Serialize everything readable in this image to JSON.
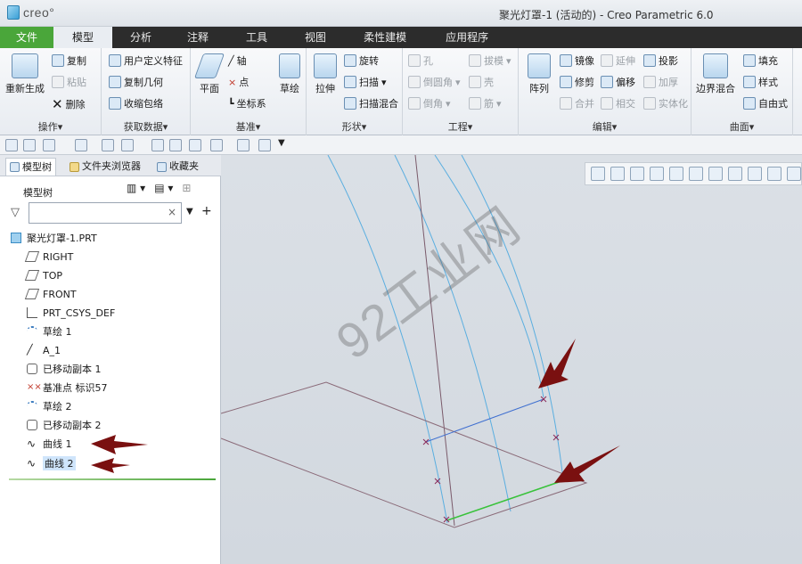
{
  "window": {
    "logo_text": "creo°",
    "title": "聚光灯罩-1 (活动的) - Creo Parametric 6.0"
  },
  "tabs": [
    {
      "label": "文件"
    },
    {
      "label": "模型"
    },
    {
      "label": "分析"
    },
    {
      "label": "注释"
    },
    {
      "label": "工具"
    },
    {
      "label": "视图"
    },
    {
      "label": "柔性建模"
    },
    {
      "label": "应用程序"
    }
  ],
  "ribbon": {
    "groups": {
      "operations": "操作▾",
      "get_data": "获取数据▾",
      "datum": "基准▾",
      "shapes": "形状▾",
      "engineering": "工程▾",
      "editing": "编辑▾",
      "surfaces": "曲面▾"
    },
    "buttons": {
      "regenerate": "重新生成",
      "copy": "复制",
      "paste": "粘贴",
      "delete": "删除",
      "udf": "用户定义特征",
      "copy_geometry": "复制几何",
      "shrinkwrap": "收缩包络",
      "plane": "平面",
      "axis": "轴",
      "point": "点",
      "csys": "坐标系",
      "sketch": "草绘",
      "extrude": "拉伸",
      "revolve": "旋转",
      "sweep": "扫描",
      "swept_blend": "扫描混合",
      "hole": "孔",
      "round": "倒圆角",
      "chamfer": "倒角",
      "draft": "拔模",
      "shell": "壳",
      "rib": "筋",
      "pattern": "阵列",
      "mirror": "镜像",
      "trim": "修剪",
      "merge": "合并",
      "extend": "延伸",
      "offset": "偏移",
      "intersect": "相交",
      "project": "投影",
      "thicken": "加厚",
      "solidify": "实体化",
      "boundary_blend": "边界混合",
      "fill": "填充",
      "style": "样式",
      "freestyle": "自由式"
    }
  },
  "panel": {
    "tabs": [
      "模型树",
      "文件夹浏览器",
      "收藏夹"
    ],
    "tree_title": "模型树",
    "search_placeholder": "",
    "tree": [
      {
        "label": "聚光灯罩-1.PRT",
        "icon": "part-icon"
      },
      {
        "label": "RIGHT",
        "icon": "datum-plane-icon"
      },
      {
        "label": "TOP",
        "icon": "datum-plane-icon"
      },
      {
        "label": "FRONT",
        "icon": "datum-plane-icon"
      },
      {
        "label": "PRT_CSYS_DEF",
        "icon": "csys-icon"
      },
      {
        "label": "草绘 1",
        "icon": "sketch-icon"
      },
      {
        "label": "A_1",
        "icon": "axis-icon"
      },
      {
        "label": "已移动副本 1",
        "icon": "moved-copy-icon"
      },
      {
        "label": "基准点 标识57",
        "icon": "datum-point-icon"
      },
      {
        "label": "草绘 2",
        "icon": "sketch-icon"
      },
      {
        "label": "已移动副本 2",
        "icon": "moved-copy-icon"
      },
      {
        "label": "曲线 1",
        "icon": "curve-icon"
      },
      {
        "label": "曲线 2",
        "icon": "curve-icon",
        "selected": true
      }
    ]
  },
  "viewport": {
    "watermark": "92工业网"
  },
  "colors": {
    "file_tab": "#4aa63a",
    "tab_bar": "#2c2c2c",
    "curve_blue": "#5aaee0",
    "selected_green": "#38c23a",
    "arrow_red": "#7a1010"
  }
}
